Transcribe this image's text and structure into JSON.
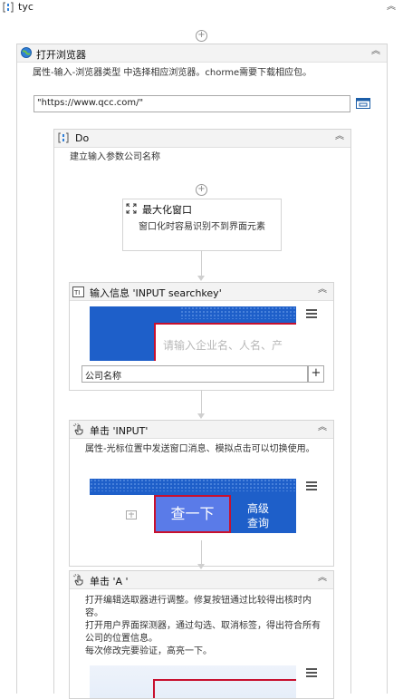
{
  "root": {
    "title": "tyc"
  },
  "open_browser": {
    "title": "打开浏览器",
    "desc": "属性-输入-浏览器类型 中选择相应浏览器。chorme需要下载相应包。",
    "url": "\"https://www.qcc.com/\""
  },
  "do": {
    "title": "Do",
    "desc": "建立输入参数公司名称"
  },
  "maximize": {
    "title": "最大化窗口",
    "desc": "窗口化时容易识别不到界面元素"
  },
  "input_info": {
    "title": "输入信息 'INPUT  searchkey'",
    "preview_placeholder": "请输入企业名、人名、产",
    "value": "公司名称"
  },
  "click_input": {
    "title": "单击 'INPUT'",
    "desc": "属性-光标位置中发送窗口消息、模拟点击可以切换使用。",
    "preview_button": "查一下",
    "preview_adv": "高级\n查询"
  },
  "click_a": {
    "title": "单击 'A '",
    "desc": "打开编辑选取器进行调整。修复按钮通过比较得出核时内容。\n打开用户界面探测器，通过勾选、取消标签，得出符合所有公司的位置信息。\n每次修改完要验证，高亮一下。"
  }
}
